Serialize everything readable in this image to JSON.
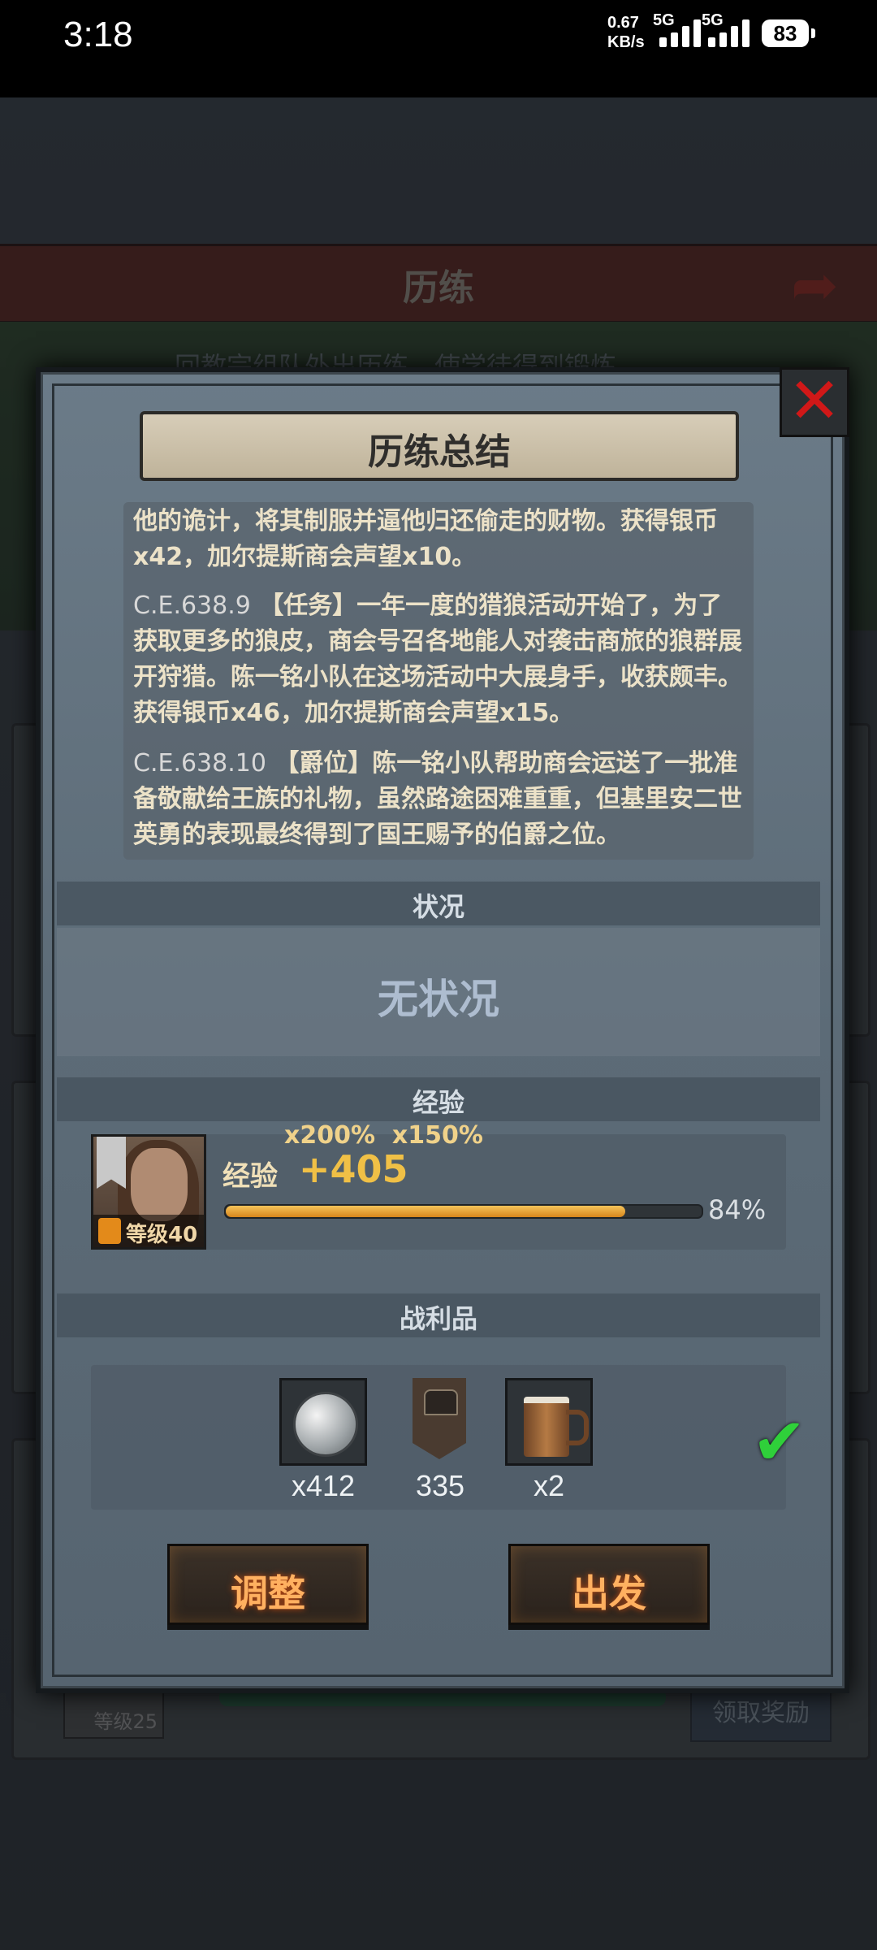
{
  "status_bar": {
    "time": "3:18",
    "net_speed": "0.67",
    "net_unit": "KB/s",
    "sim1": "5G",
    "sim2": "5G",
    "battery": "83"
  },
  "background": {
    "screen_title": "历练",
    "subtitle": "回教宗组队外出历练，使学徒得到锻炼",
    "bottom_level": "等级25",
    "claim_button": "领取奖励"
  },
  "dialog": {
    "title": "历练总结",
    "close_icon": "close-x-icon",
    "log": [
      {
        "date": "",
        "text": "他的诡计，将其制服并逼他归还偷走的财物。获得银币x42，加尔提斯商会声望x10。"
      },
      {
        "date": "C.E.638.9",
        "text": "【任务】一年一度的猎狼活动开始了，为了获取更多的狼皮，商会号召各地能人对袭击商旅的狼群展开狩猎。陈一铭小队在这场活动中大展身手，收获颇丰。获得银币x46，加尔提斯商会声望x15。"
      },
      {
        "date": "C.E.638.10",
        "text": "【爵位】陈一铭小队帮助商会运送了一批准备敬献给王族的礼物，虽然路途困难重重，但基里安二世英勇的表现最终得到了国王赐予的伯爵之位。"
      }
    ],
    "status_section": {
      "label": "状况",
      "value": "无状况"
    },
    "exp_section": {
      "label": "经验",
      "hero_level": "等级40",
      "multiplier_1": "x200%",
      "multiplier_2": "x150%",
      "exp_label": "经验",
      "exp_gain": "+405",
      "progress_percent": 84,
      "progress_text": "84%"
    },
    "loot_section": {
      "label": "战利品",
      "items": [
        {
          "icon": "silver-coin-icon",
          "count": "x412"
        },
        {
          "icon": "chest-banner-icon",
          "count": "335"
        },
        {
          "icon": "beer-mug-icon",
          "count": "x2"
        }
      ],
      "check_icon": "check-icon"
    },
    "buttons": {
      "adjust": "调整",
      "depart": "出发"
    }
  },
  "colors": {
    "button_text": "#ffb060",
    "exp_bar": "#e8a030",
    "close_x": "#d01818",
    "check": "#2fd03a"
  }
}
